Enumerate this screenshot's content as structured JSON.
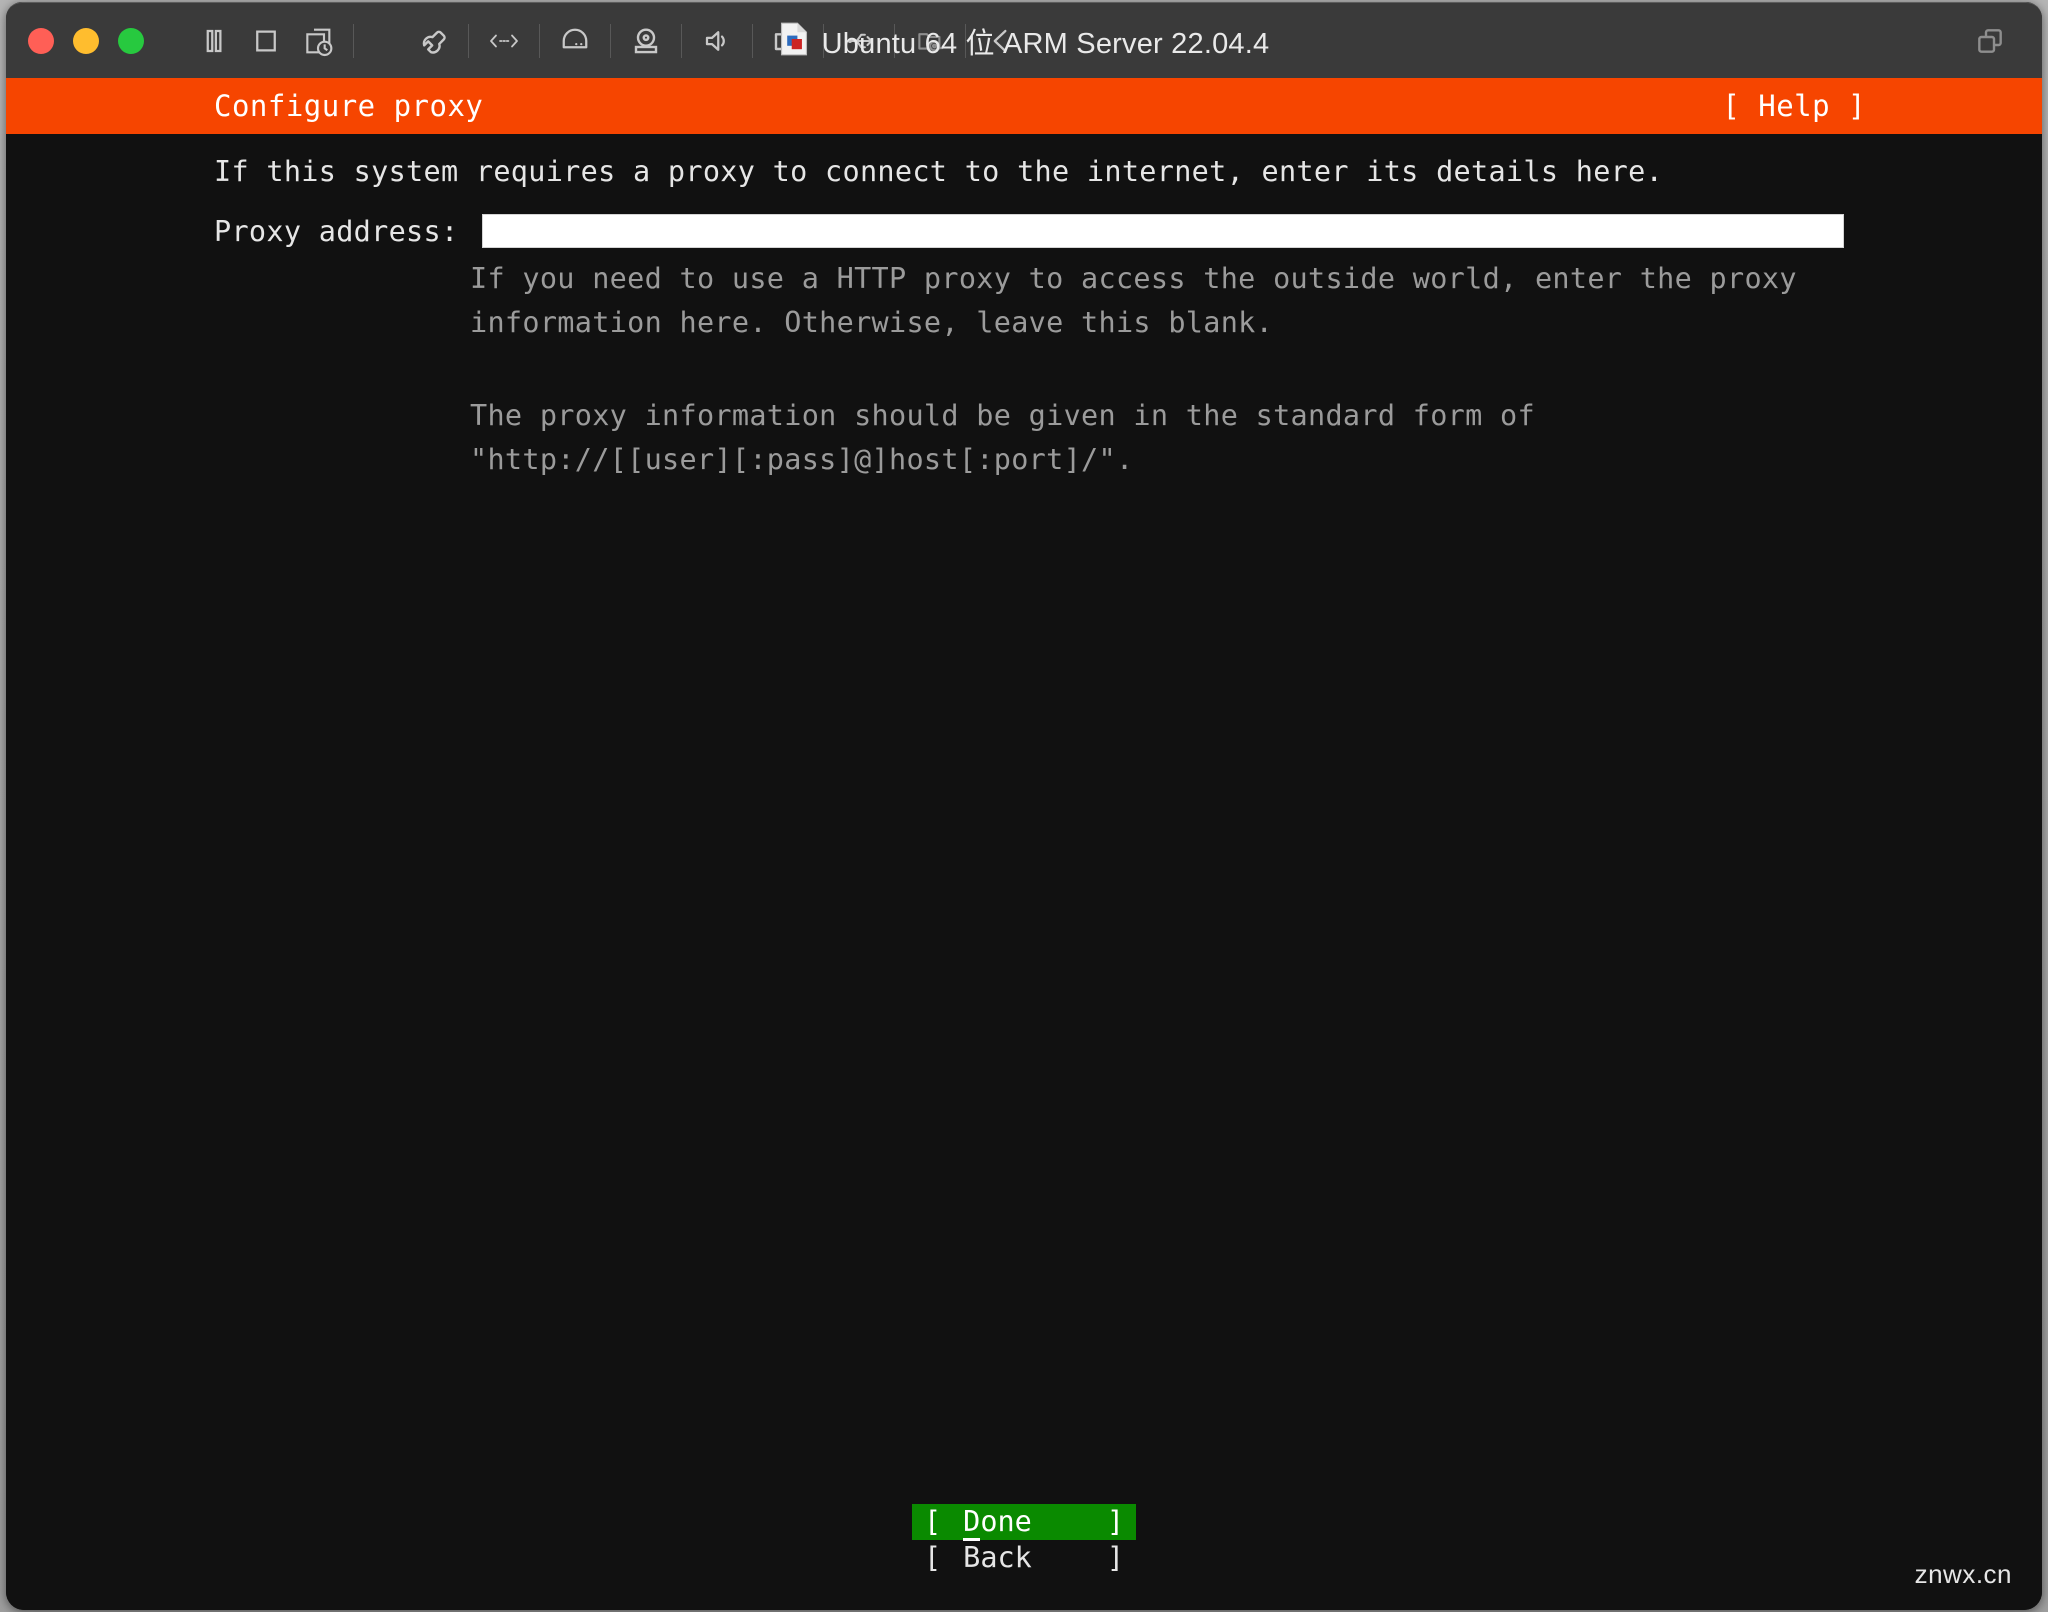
{
  "window": {
    "title": "Ubuntu 64 位 ARM Server 22.04.4",
    "traffic_lights": [
      {
        "name": "close",
        "color": "#ff5f56"
      },
      {
        "name": "minimize",
        "color": "#ffbd2e"
      },
      {
        "name": "maximize",
        "color": "#27c93f"
      }
    ],
    "toolbar_icons": [
      "pause-icon",
      "stop-icon",
      "snapshot-icon",
      "settings-wrench-icon",
      "network-icon",
      "harddisk-icon",
      "optical-drive-icon",
      "sound-icon",
      "camera-icon",
      "usb-icon",
      "shared-folder-icon",
      "back-chevron-icon"
    ],
    "right_icon": "duplicate-windows-icon"
  },
  "installer": {
    "header": {
      "title": "Configure proxy",
      "help_label": "[ Help ]",
      "bar_color": "#f64500"
    },
    "intro": "If this system requires a proxy to connect to the internet, enter its details here.",
    "field": {
      "label": "Proxy address:",
      "value": "",
      "placeholder": ""
    },
    "help_paragraph_1": [
      "If you need to use a HTTP proxy to access the outside world, enter the proxy",
      "information here. Otherwise, leave this blank."
    ],
    "help_paragraph_2": [
      "The proxy information should be given in the standard form of",
      "\"http://[[user][:pass]@]host[:port]/\"."
    ],
    "buttons": [
      {
        "open_bracket": "[",
        "hotkey": "D",
        "rest": "one",
        "close_bracket": "]",
        "selected": true,
        "name": "done"
      },
      {
        "open_bracket": "[",
        "hotkey": "B",
        "rest": "ack",
        "close_bracket": "]",
        "selected": false,
        "name": "back"
      }
    ],
    "selected_color": "#0a8a00"
  },
  "watermark": "znwx.cn"
}
